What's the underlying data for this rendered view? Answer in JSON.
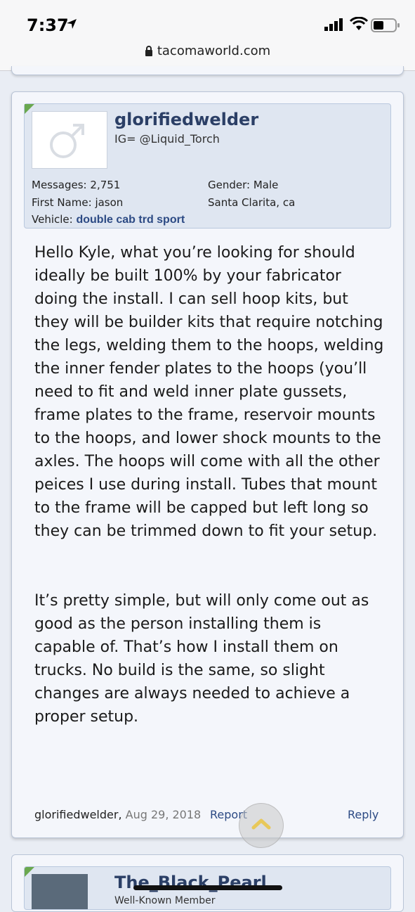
{
  "status_bar": {
    "time": "7:37"
  },
  "browser": {
    "url": "tacomaworld.com"
  },
  "post": {
    "username": "glorifiedwelder",
    "user_title": "IG= @Liquid_Torch",
    "stats": {
      "messages_label": "Messages:",
      "messages_value": "2,751",
      "gender_label": "Gender:",
      "gender_value": "Male",
      "first_name_label": "First Name:",
      "first_name_value": "jason",
      "location": "Santa Clarita, ca",
      "vehicle_label": "Vehicle:",
      "vehicle_value": "double cab trd sport"
    },
    "paragraphs": [
      "Hello Kyle, what you’re looking for should ideally be built 100% by your fabricator doing the install. I can sell hoop kits, but they will be builder kits that require notching the legs, welding them to the hoops, welding the inner fender plates to the hoops (you’ll need to fit and weld inner plate gussets, frame plates to the frame, reservoir mounts to the hoops, and lower shock mounts to the axles. The hoops will come with all the other peices I use during install. Tubes that mount to the frame will be capped but left long so they can be trimmed down to fit your setup.",
      "It’s pretty simple, but will only come out as good as the person installing them is capable of. That’s how I install them on trucks. No build is the same, so slight changes are always needed to achieve a proper setup."
    ],
    "footer": {
      "author": "glorifiedwelder,",
      "date": "Aug 29, 2018",
      "report_label": "Report",
      "reply_label": "Reply"
    }
  },
  "next_post": {
    "username": "The_Black_Pearl",
    "user_title": "Well-Known Member"
  }
}
